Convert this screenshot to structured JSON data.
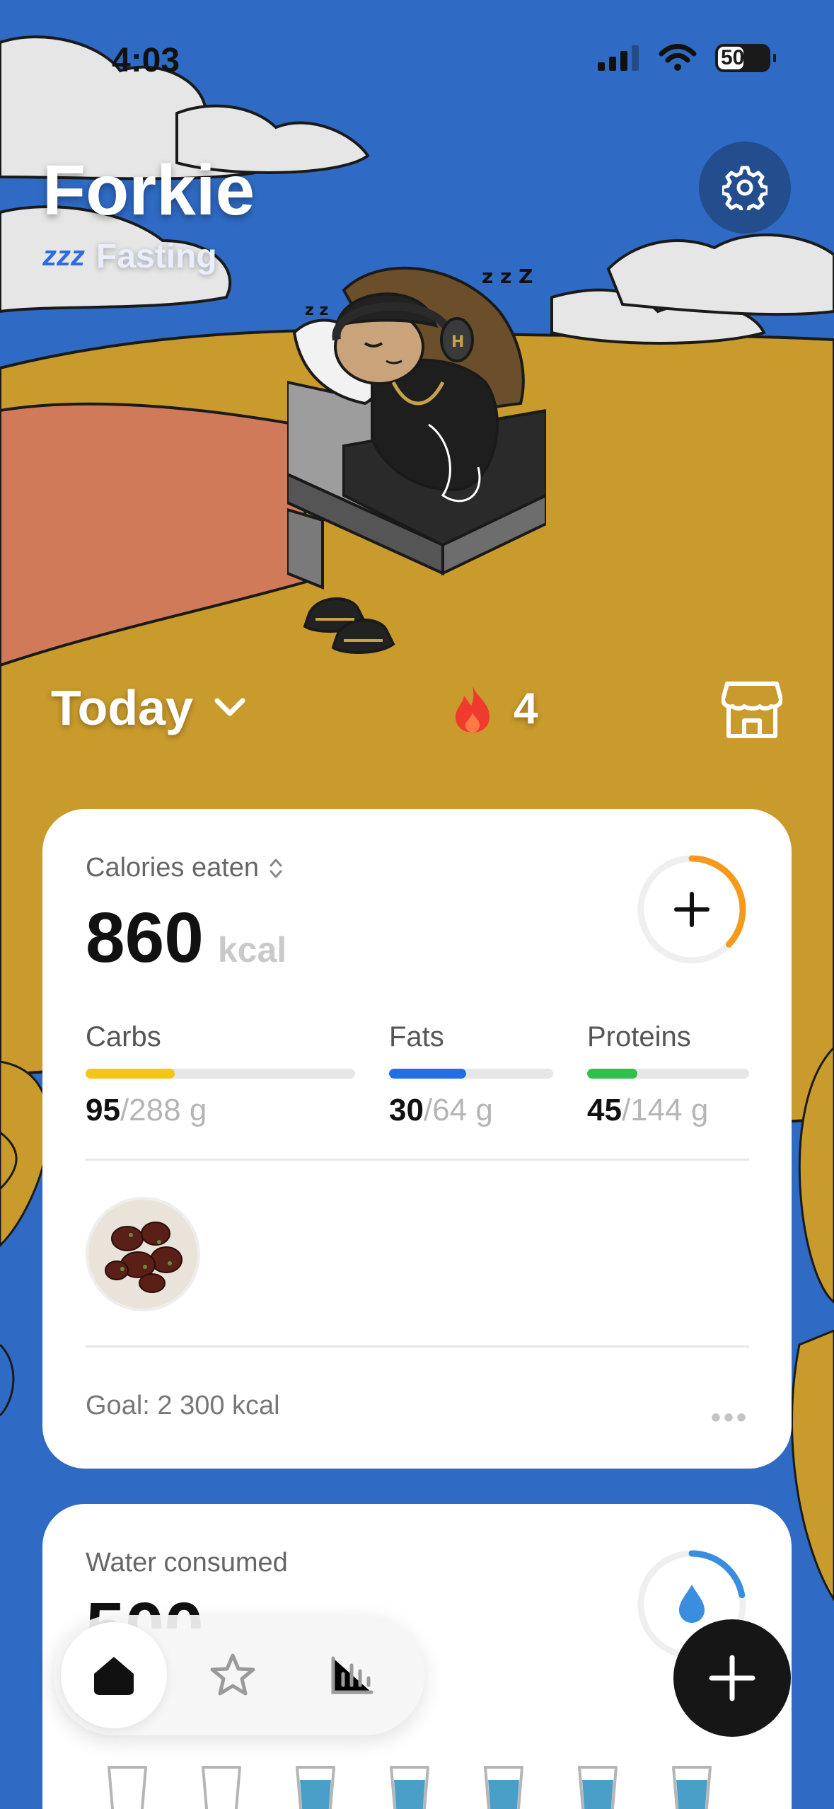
{
  "status_bar": {
    "time": "4:03",
    "battery": "50"
  },
  "header": {
    "title": "Forkie",
    "status_icon": "zzz",
    "status": "Fasting"
  },
  "day": {
    "label": "Today"
  },
  "streak": {
    "count": "4"
  },
  "calories": {
    "label": "Calories eaten",
    "value": "860",
    "unit": "kcal",
    "progress": 0.37,
    "macros": [
      {
        "name": "Carbs",
        "eaten": "95",
        "goal": "/288 g",
        "progress": 0.33,
        "color": "#f5c518"
      },
      {
        "name": "Fats",
        "eaten": "30",
        "goal": "/64 g",
        "progress": 0.47,
        "color": "#1f6fe5"
      },
      {
        "name": "Proteins",
        "eaten": "45",
        "goal": "/144 g",
        "progress": 0.31,
        "color": "#2fbf4a"
      }
    ],
    "goal": "Goal: 2 300 kcal"
  },
  "water": {
    "label": "Water consumed",
    "value": "500",
    "progress": 0.22,
    "glasses_total": 7,
    "glasses_filled": 5
  },
  "colors": {
    "accent_orange": "#f59a1a",
    "water_blue": "#3b8de0",
    "sky": "#2f6bc4",
    "sand": "#c99a2c"
  },
  "tabbar": {
    "tabs": [
      "home-icon",
      "star-icon",
      "chart-icon"
    ],
    "active": 0
  }
}
